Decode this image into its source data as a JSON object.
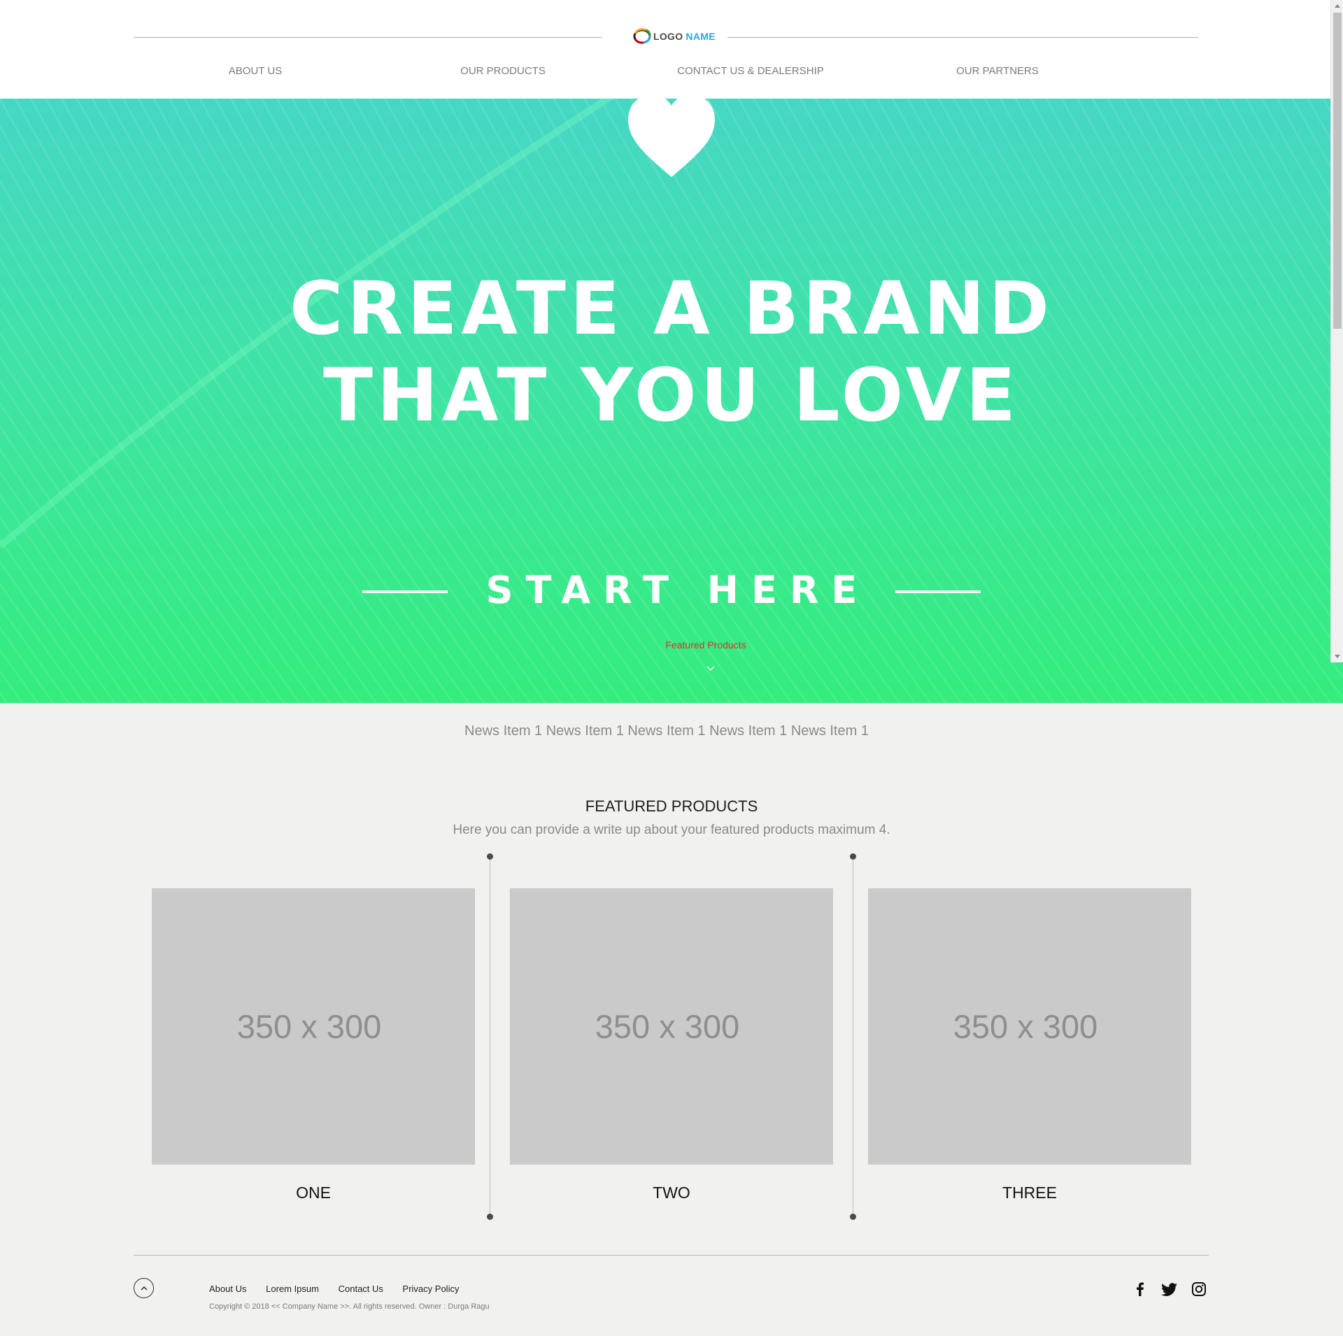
{
  "header": {
    "logo_text": "LOGO",
    "logo_text_accent": "NAME",
    "nav": [
      "ABOUT US",
      "OUR PRODUCTS",
      "CONTACT US & DEALERSHIP",
      "OUR PARTNERS"
    ]
  },
  "hero": {
    "title_line1": "CREATE A BRAND",
    "title_line2": "THAT YOU LOVE",
    "cta": "START HERE",
    "featured_link": "Featured Products"
  },
  "news": {
    "ticker": "News Item 1 News Item 1 News Item 1 News Item 1 News Item 1"
  },
  "featured": {
    "title": "FEATURED PRODUCTS",
    "subtitle": "Here you can provide a write up about your featured products maximum 4.",
    "cards": [
      {
        "image_text": "350 x 300",
        "label": "ONE"
      },
      {
        "image_text": "350 x 300",
        "label": "TWO"
      },
      {
        "image_text": "350 x 300",
        "label": "THREE"
      }
    ]
  },
  "footer": {
    "links": [
      "About Us",
      "Lorem Ipsum",
      "Contact Us",
      "Privacy Policy"
    ],
    "copyright": "Copyright © 2018 << Company Name >>. All rights reserved. Owner : Durga Ragu",
    "social_icons": [
      "facebook-icon",
      "twitter-icon",
      "instagram-icon"
    ]
  },
  "colors": {
    "hero_top": "#45d7c5",
    "hero_bottom": "#33ed7c",
    "featured_link": "#e0322a",
    "logo_accent": "#27aae1",
    "page_background": "#f1f1ef"
  }
}
